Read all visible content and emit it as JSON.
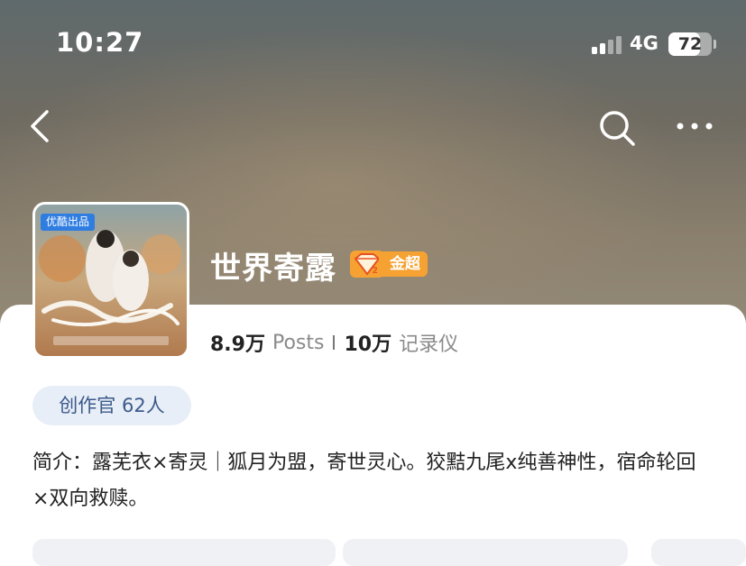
{
  "status_bar": {
    "time": "10:27",
    "network": "4G",
    "battery": "72",
    "battery_level": 0.72
  },
  "nav": {
    "back_icon": "chevron-left-icon",
    "search_icon": "search-icon",
    "more_icon": "more-dots-icon"
  },
  "topic": {
    "title": "世界寄露",
    "badge_label": "金超",
    "badge_icon": "diamond-level-icon",
    "posts_count": "8.9万",
    "posts_label": "Posts",
    "records_count": "10万",
    "records_label": "记录仪",
    "creator_pill": "创作官 62人",
    "intro": "简介：露芜衣×寄灵｜狐月为盟，寄世灵心。狡黠九尾x纯善神性，宿命轮回×双向救赎。"
  },
  "avatar": {
    "badge": "优酷出品"
  },
  "colors": {
    "badge_orange": "#f6a233",
    "pill_bg": "#e8eef7",
    "pill_text": "#3b5a8a"
  }
}
